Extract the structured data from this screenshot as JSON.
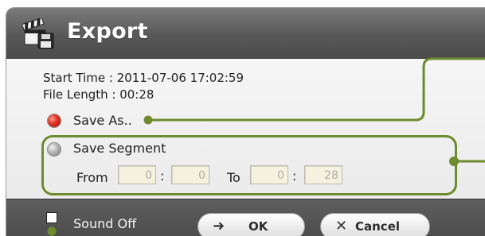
{
  "dialog": {
    "title": "Export",
    "title_icon": "clapperboard-save-icon"
  },
  "info": {
    "start_time": "Start Time : 2011-07-06 17:02:59",
    "file_length": "File Length : 00:28"
  },
  "options": {
    "save_as_label": "Save As..",
    "save_as_selected": true,
    "save_segment_label": "Save Segment",
    "save_segment_selected": false
  },
  "segment": {
    "from_label": "From",
    "from_min": "0",
    "from_sec": "0",
    "to_label": "To",
    "to_min": "0",
    "to_sec": "28",
    "separator": ":"
  },
  "footer": {
    "sound_off_label": "Sound Off",
    "sound_off_checked": false,
    "ok_label": "OK",
    "ok_icon": "arrow-right-icon",
    "cancel_label": "Cancel",
    "cancel_icon": "close-x-icon"
  },
  "colors": {
    "callout": "#6e8b2e",
    "radio_selected": "#e02c1c",
    "titlebar": "#585858"
  }
}
